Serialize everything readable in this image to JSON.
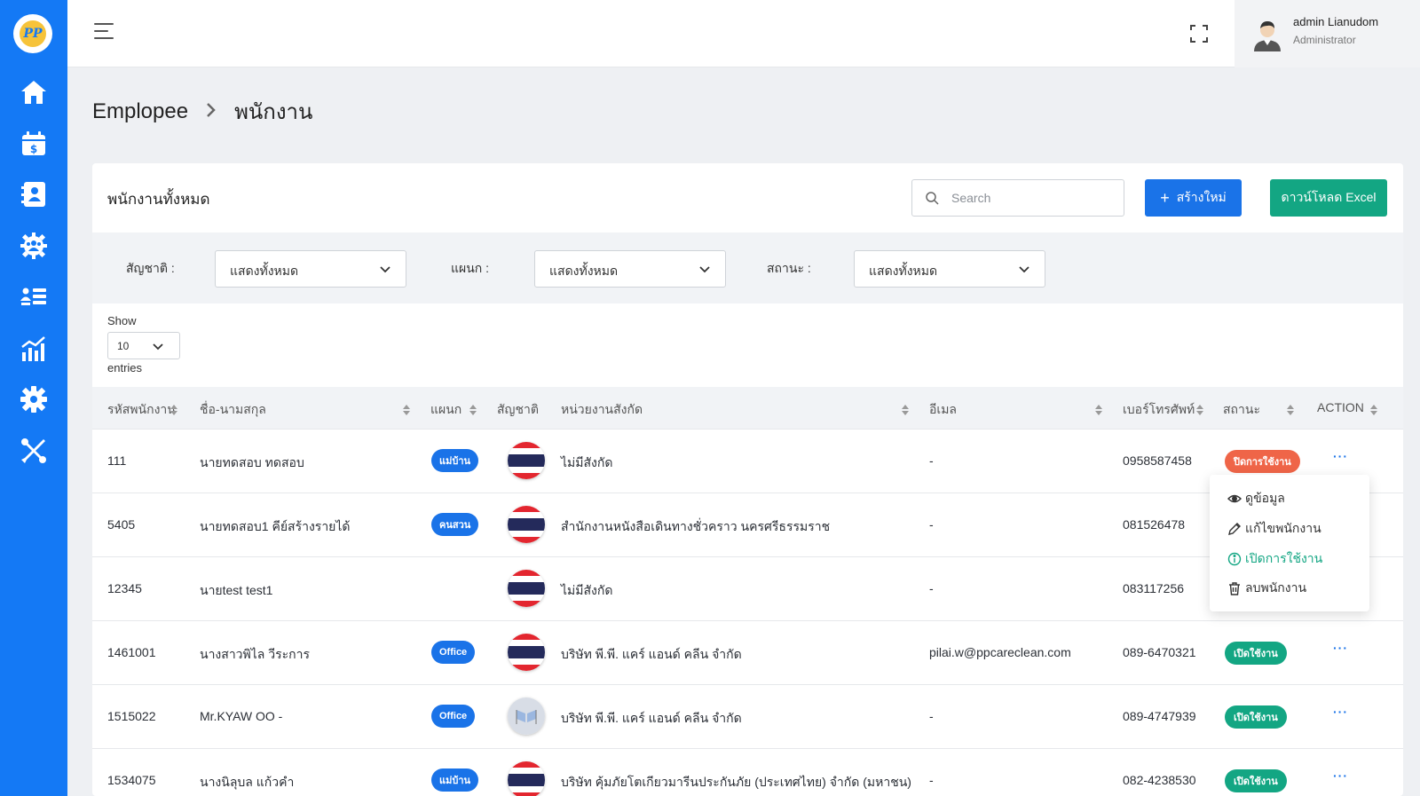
{
  "sidebar": {
    "logo_text": "PP",
    "items": [
      {
        "name": "home",
        "icon": "home-icon"
      },
      {
        "name": "payroll",
        "icon": "calendar-dollar-icon"
      },
      {
        "name": "contacts",
        "icon": "address-book-icon"
      },
      {
        "name": "employees",
        "icon": "users-gear-icon"
      },
      {
        "name": "list",
        "icon": "user-list-icon"
      },
      {
        "name": "reports",
        "icon": "chart-icon"
      },
      {
        "name": "settings",
        "icon": "gear-icon"
      },
      {
        "name": "tools",
        "icon": "tools-icon"
      }
    ],
    "accent": "#1479f5"
  },
  "topbar": {
    "user_name": "admin Lianudom",
    "user_role": "Administrator"
  },
  "breadcrumb": {
    "parent": "Emplopee",
    "separator": ">",
    "current": "พนักงาน"
  },
  "card": {
    "title": "พนักงานทั้งหมด",
    "search_placeholder": "Search",
    "create_label": "สร้างใหม่",
    "create_plus": "+",
    "excel_label": "ดาวน์โหลด Excel"
  },
  "filters": [
    {
      "label": "สัญชาติ :",
      "value": "แสดงทั้งหมด"
    },
    {
      "label": "แผนก :",
      "value": "แสดงทั้งหมด"
    },
    {
      "label": "สถานะ :",
      "value": "แสดงทั้งหมด"
    }
  ],
  "pagination": {
    "show_label": "Show",
    "page_size": "10",
    "entries_label": "entries"
  },
  "table": {
    "headers": [
      "รหัสพนักงาน",
      "ชื่อ-นามสกุล",
      "แผนก",
      "สัญชาติ",
      "หน่วยงานสังกัด",
      "อีเมล",
      "เบอร์โทรศัพท์",
      "สถานะ",
      "ACTION"
    ],
    "rows": [
      {
        "id": "111",
        "name": "นายทดสอบ ทดสอบ",
        "dept": "แม่บ้าน",
        "nationality": "thai",
        "org": "ไม่มีสังกัด",
        "email": "-",
        "phone": "0958587458",
        "status": "ปิดการใช้งาน",
        "status_type": "off",
        "action": "···"
      },
      {
        "id": "5405",
        "name": "นายทดสอบ1 คีย์สร้างรายได้",
        "dept": "คนสวน",
        "nationality": "thai",
        "org": "สำนักงานหนังสือเดินทางชั่วคราว นครศรีธรรมราช",
        "email": "-",
        "phone": "081526478",
        "status": "",
        "status_type": "",
        "action": ""
      },
      {
        "id": "12345",
        "name": "นายtest test1",
        "dept": "",
        "nationality": "thai",
        "org": "ไม่มีสังกัด",
        "email": "-",
        "phone": "083117256",
        "status": "",
        "status_type": "",
        "action": ""
      },
      {
        "id": "1461001",
        "name": "นางสาวพิไล วีระการ",
        "dept": "Office",
        "nationality": "thai",
        "org": "บริษัท พี.พี. แคร์ แอนด์ คลีน จำกัด",
        "email": "pilai.w@ppcareclean.com",
        "phone": "089-6470321",
        "status": "เปิดใช้งาน",
        "status_type": "on",
        "action": "···"
      },
      {
        "id": "1515022",
        "name": "Mr.KYAW OO -",
        "dept": "Office",
        "nationality": "myanmar",
        "org": "บริษัท พี.พี. แคร์ แอนด์ คลีน จำกัด",
        "email": "-",
        "phone": "089-4747939",
        "status": "เปิดใช้งาน",
        "status_type": "on",
        "action": "···"
      },
      {
        "id": "1534075",
        "name": "นางนิลุบล แก้วคำ",
        "dept": "แม่บ้าน",
        "nationality": "thai",
        "org": "บริษัท คุ้มภัยโตเกียวมารีนประกันภัย (ประเทศไทย) จำกัด (มหาชน)",
        "email": "-",
        "phone": "082-4238530",
        "status": "เปิดใช้งาน",
        "status_type": "on",
        "action": "···"
      }
    ]
  },
  "action_menu": {
    "items": [
      {
        "label": "ดูข้อมูล",
        "icon": "eye-icon"
      },
      {
        "label": "แก้ไขพนักงาน",
        "icon": "pencil-icon"
      },
      {
        "label": "เปิดการใช้งาน",
        "icon": "info-icon"
      },
      {
        "label": "ลบพนักงาน",
        "icon": "trash-icon"
      }
    ]
  },
  "colors": {
    "primary": "#1a73e8",
    "success": "#13a683",
    "danger": "#ef6548"
  }
}
